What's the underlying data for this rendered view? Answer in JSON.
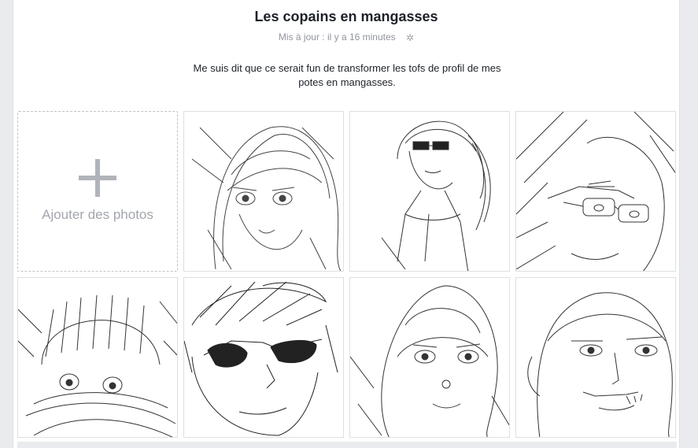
{
  "album": {
    "title": "Les copains en mangasses",
    "updated": "Mis à jour : il y a 16 minutes",
    "settings_icon": "gear-icon",
    "description": "Me suis dit que ce serait fun de transformer les tofs de profil de mes potes en mangasses."
  },
  "add_photos": {
    "icon": "plus-icon",
    "label": "Ajouter des photos"
  },
  "photos": [
    {
      "subject": "woman-portrait-sketch"
    },
    {
      "subject": "woman-sunglasses-sketch"
    },
    {
      "subject": "man-glasses-sketch"
    },
    {
      "subject": "person-beanie-scarf-sketch"
    },
    {
      "subject": "man-sunglasses-sketch"
    },
    {
      "subject": "woman-nose-ring-sketch"
    },
    {
      "subject": "bald-man-sketch"
    }
  ]
}
